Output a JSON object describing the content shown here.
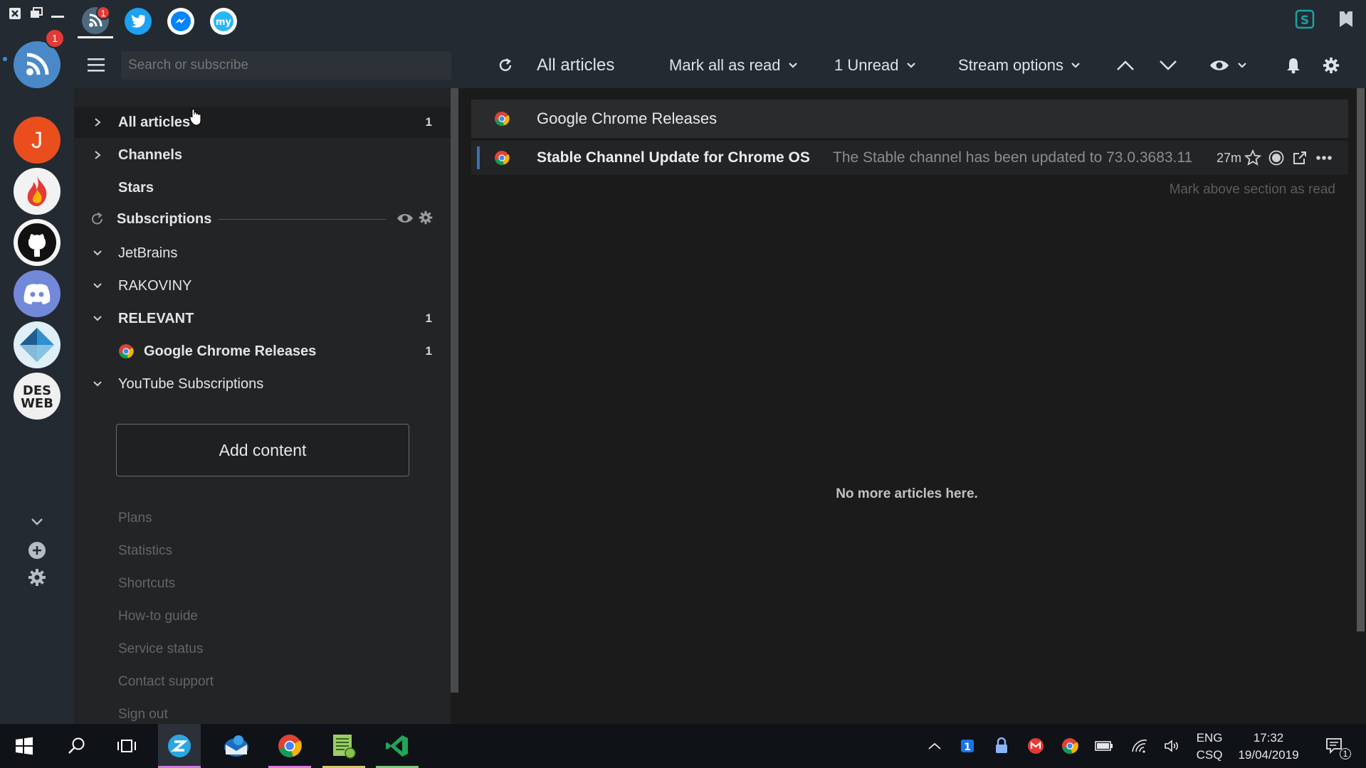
{
  "topbar": {
    "feedly_tab_badge": "1"
  },
  "rail": {
    "feedly_badge": "1",
    "jira_letter": "J"
  },
  "header": {
    "search_placeholder": "Search or subscribe",
    "title": "All articles",
    "mark_all_read": "Mark all as read",
    "unread": "1 Unread",
    "stream_options": "Stream options"
  },
  "sidebar": {
    "items": [
      {
        "label": "All articles",
        "count": "1"
      },
      {
        "label": "Channels"
      },
      {
        "label": "Stars"
      },
      {
        "label": "Subscriptions"
      },
      {
        "label": "JetBrains"
      },
      {
        "label": "RAKOVINY"
      },
      {
        "label": "RELEVANT",
        "count": "1"
      },
      {
        "label": "Google Chrome Releases",
        "count": "1"
      },
      {
        "label": "YouTube Subscriptions"
      }
    ],
    "add_content": "Add content",
    "footer": [
      "Plans",
      "Statistics",
      "Shortcuts",
      "How-to guide",
      "Service status",
      "Contact support",
      "Sign out"
    ]
  },
  "main": {
    "feed_title": "Google Chrome Releases",
    "article": {
      "title": "Stable Channel Update for Chrome OS",
      "summary": "The Stable channel has been updated to 73.0.3683.11",
      "age": "27m"
    },
    "mark_above": "Mark above section as read",
    "no_more": "No more articles here."
  },
  "taskbar": {
    "lang": "ENG",
    "layout": "CSQ",
    "time": "17:32",
    "date": "19/04/2019",
    "notifications": "1"
  },
  "colors": {
    "accent_blue": "#3b6fb3",
    "badge_red": "#e53935"
  }
}
